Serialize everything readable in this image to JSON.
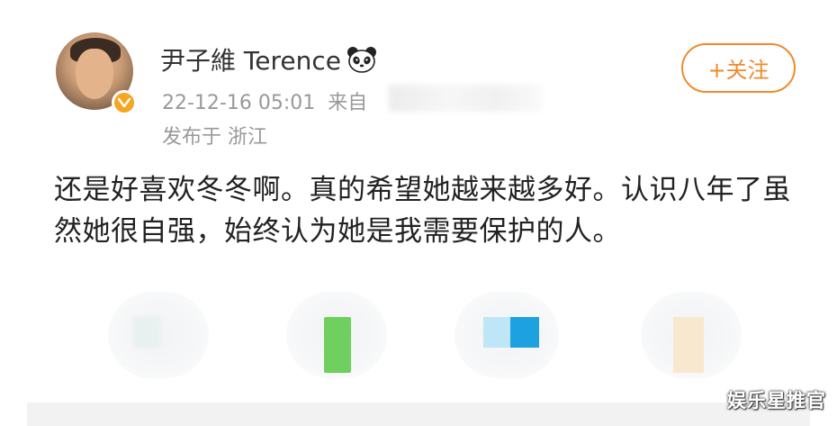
{
  "post": {
    "author": {
      "name": "尹子維 Terence",
      "avatar_icon": "user-avatar",
      "badge_icon": "verified-badge-icon",
      "emoji_icon": "panda-icon"
    },
    "timestamp": "22-12-16 05:01",
    "source_label": "来自",
    "location": "发布于 浙江",
    "follow_label": "+关注",
    "text": "还是好喜欢冬冬啊。真的希望她越来越多好。认识八年了虽然她很自强，始终认为她是我需要保护的人。"
  },
  "watermark": "娱乐星推官",
  "colors": {
    "accent": "#f08a2c",
    "badge": "#f5a623",
    "meta_text": "#999999",
    "body_text": "#222222"
  }
}
